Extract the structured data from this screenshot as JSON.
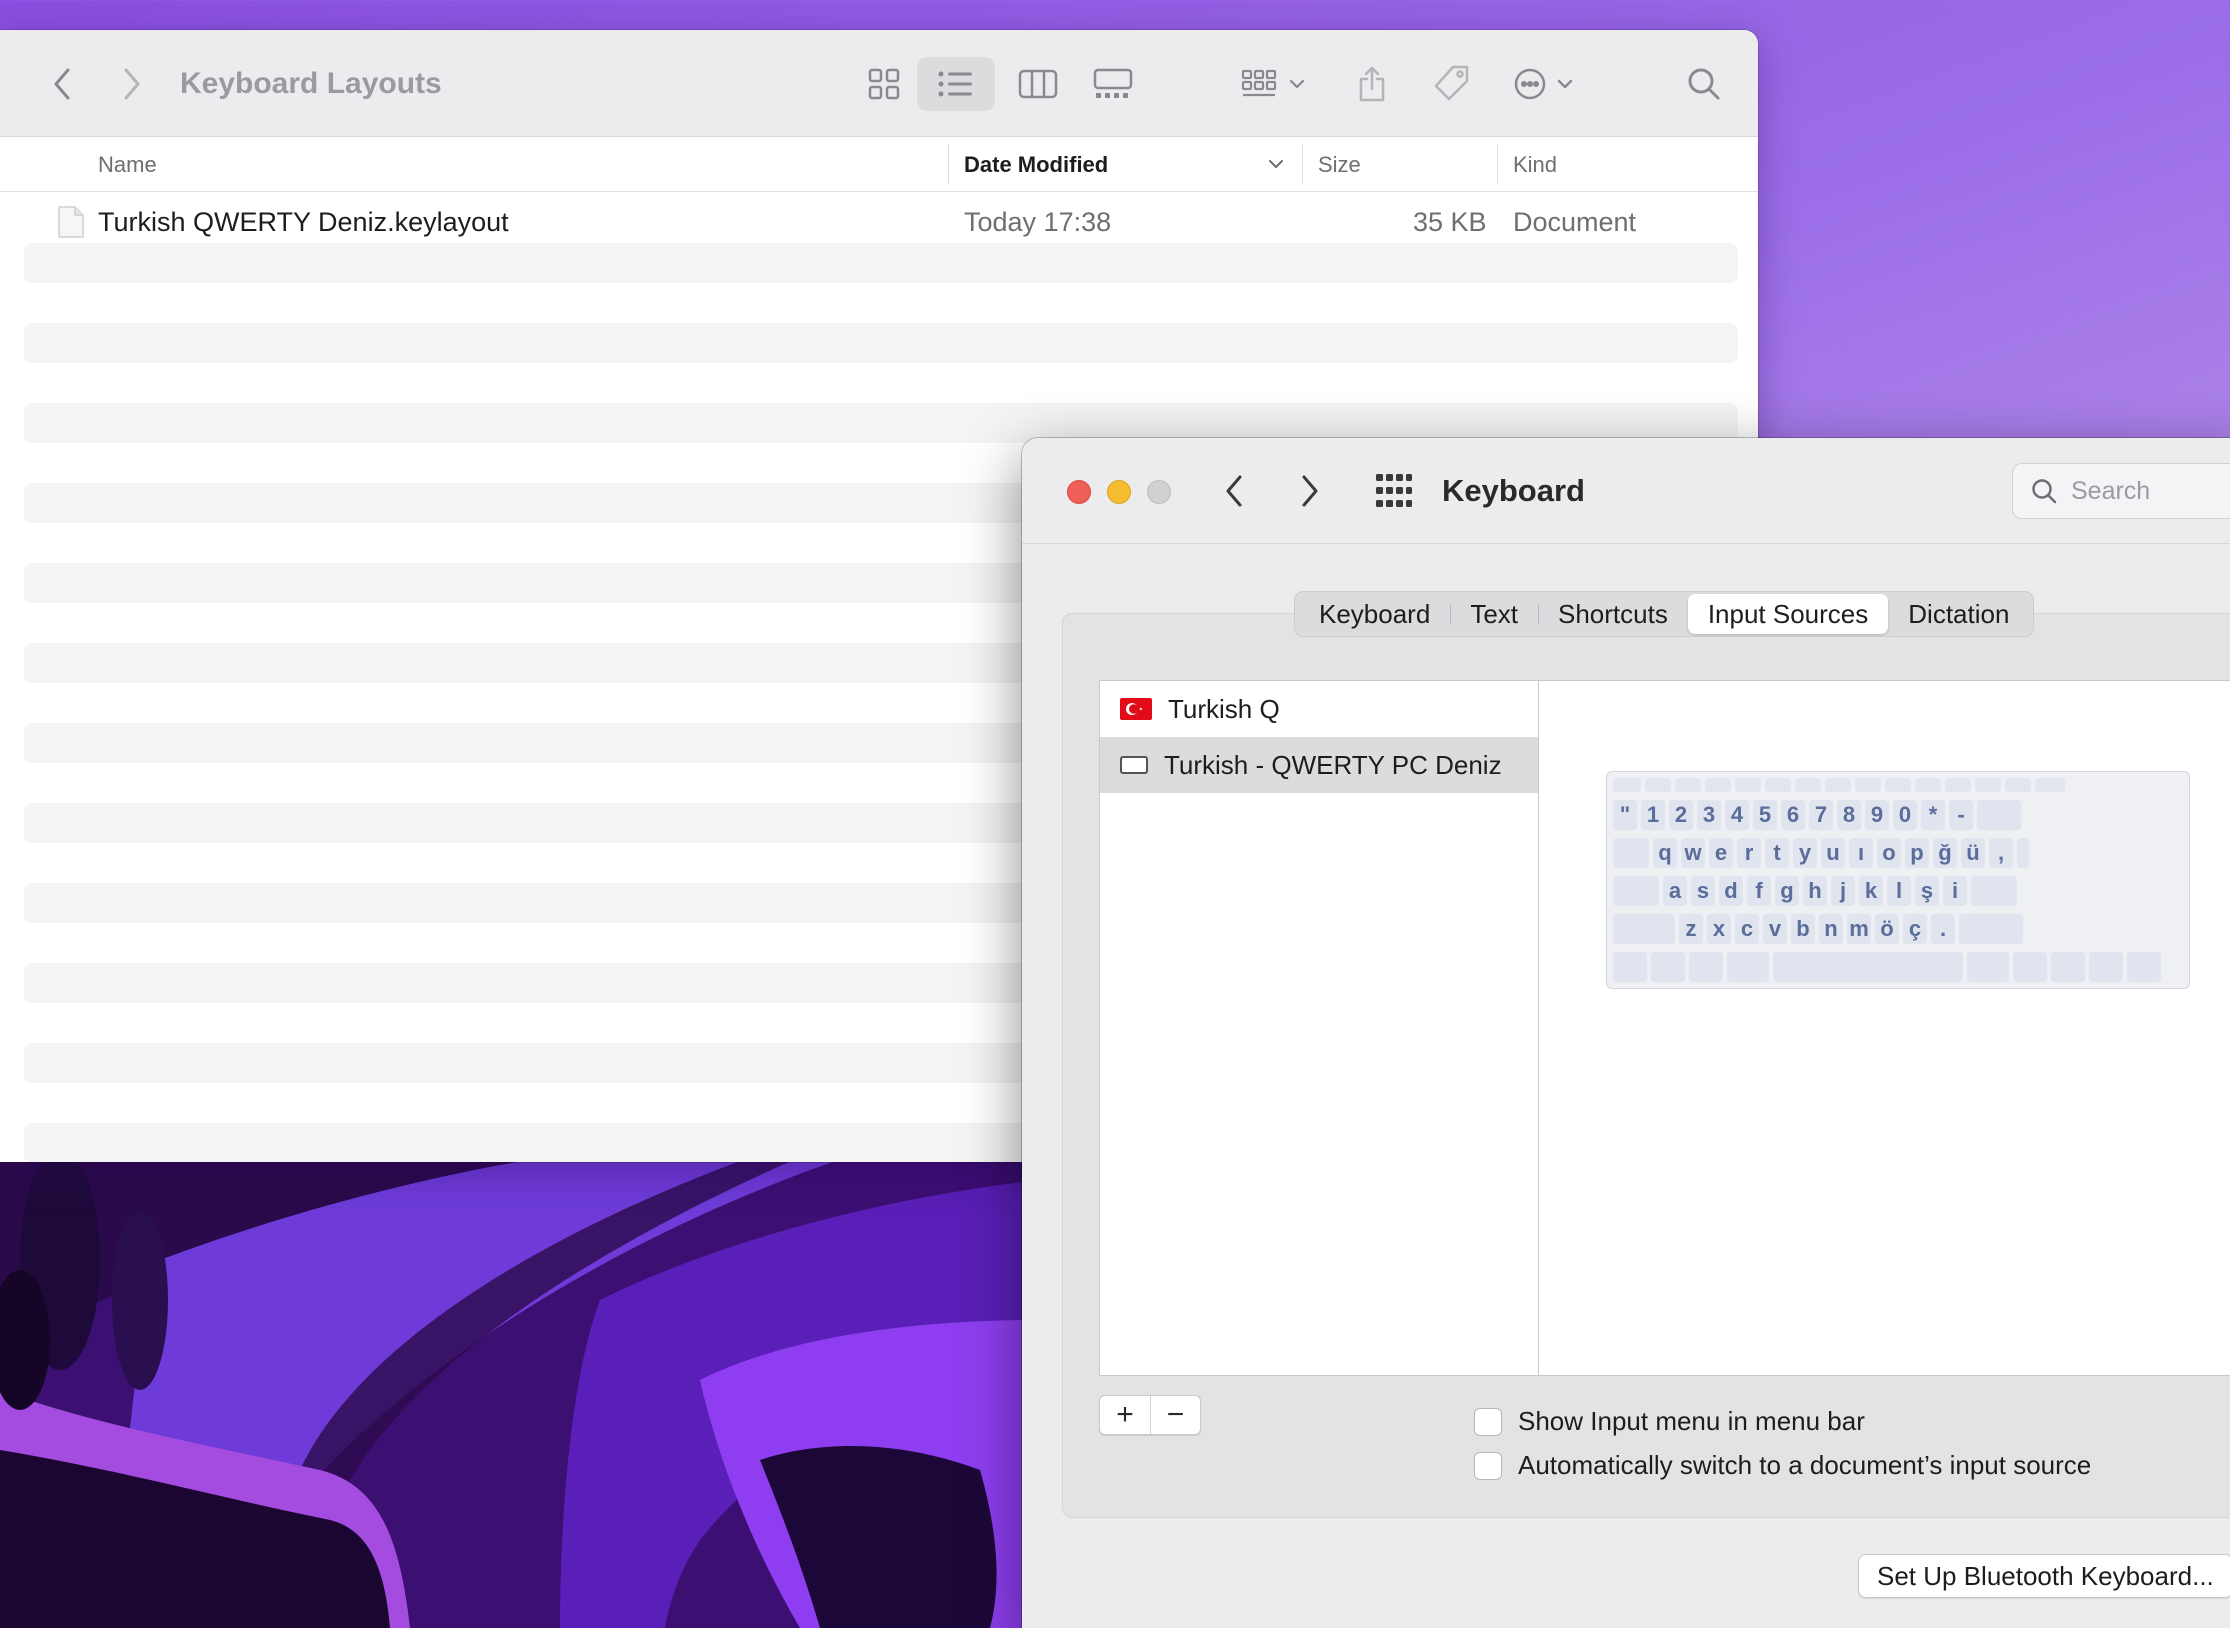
{
  "finder": {
    "title": "Keyboard Layouts",
    "columns": {
      "name": "Name",
      "date_modified": "Date Modified",
      "size": "Size",
      "kind": "Kind"
    },
    "files": [
      {
        "name": "Turkish QWERTY Deniz.keylayout",
        "date": "Today 17:38",
        "size": "35 KB",
        "kind": "Document"
      }
    ],
    "icons": [
      "back-icon",
      "forward-icon",
      "icon-view-icon",
      "list-view-icon",
      "column-view-icon",
      "gallery-view-icon",
      "group-icon",
      "share-icon",
      "tag-icon",
      "more-icon",
      "search-icon"
    ]
  },
  "prefs": {
    "title": "Keyboard",
    "search_placeholder": "Search",
    "tabs": [
      "Keyboard",
      "Text",
      "Shortcuts",
      "Input Sources",
      "Dictation"
    ],
    "selected_tab": "Input Sources",
    "input_sources": [
      {
        "label": "Turkish Q",
        "icon": "turkey-flag-icon"
      },
      {
        "label": "Turkish - QWERTY PC Deniz",
        "icon": "keyboard-icon",
        "selected": true
      }
    ],
    "keyboard_rows": [
      [
        "\"",
        "1",
        "2",
        "3",
        "4",
        "5",
        "6",
        "7",
        "8",
        "9",
        "0",
        "*",
        "-"
      ],
      [
        "q",
        "w",
        "e",
        "r",
        "t",
        "y",
        "u",
        "ı",
        "o",
        "p",
        "ğ",
        "ü",
        ","
      ],
      [
        "a",
        "s",
        "d",
        "f",
        "g",
        "h",
        "j",
        "k",
        "l",
        "ş",
        "i"
      ],
      [
        "z",
        "x",
        "c",
        "v",
        "b",
        "n",
        "m",
        "ö",
        "ç",
        "."
      ]
    ],
    "add_label": "+",
    "remove_label": "−",
    "options": [
      {
        "label": "Show Input menu in menu bar",
        "checked": false
      },
      {
        "label": "Automatically switch to a document’s input source",
        "checked": false
      }
    ],
    "bluetooth_button": "Set Up Bluetooth Keyboard..."
  },
  "colors": {
    "close": "#ee5f57",
    "minimize": "#f5bd2f",
    "zoom": "#d0d0d3",
    "flag_red": "#e30a17",
    "key_text": "#5a6d9b"
  }
}
